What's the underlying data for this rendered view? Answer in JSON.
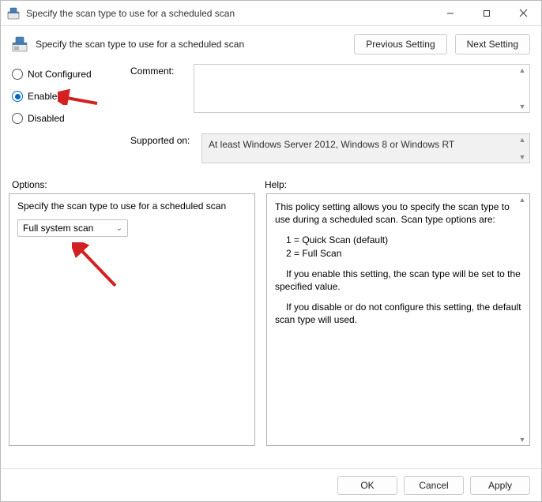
{
  "window": {
    "title": "Specify the scan type to use for a scheduled scan"
  },
  "header": {
    "subtitle": "Specify the scan type to use for a scheduled scan",
    "prev": "Previous Setting",
    "next": "Next Setting"
  },
  "radios": {
    "not_configured": "Not Configured",
    "enabled": "Enabled",
    "disabled": "Disabled",
    "selected": "enabled"
  },
  "fields": {
    "comment_label": "Comment:",
    "supported_label": "Supported on:",
    "supported_text": "At least Windows Server 2012, Windows 8 or Windows RT"
  },
  "sections": {
    "options": "Options:",
    "help": "Help:"
  },
  "options_pane": {
    "caption": "Specify the scan type to use for a scheduled scan",
    "select_value": "Full system scan"
  },
  "help_pane": {
    "p1": "This policy setting allows you to specify the scan type to use during a scheduled scan. Scan type options are:",
    "p2": "1 = Quick Scan (default)",
    "p3": "2 = Full Scan",
    "p4": "If you enable this setting, the scan type will be set to the specified value.",
    "p5": "If you disable or do not configure this setting, the default scan type will used."
  },
  "footer": {
    "ok": "OK",
    "cancel": "Cancel",
    "apply": "Apply"
  }
}
